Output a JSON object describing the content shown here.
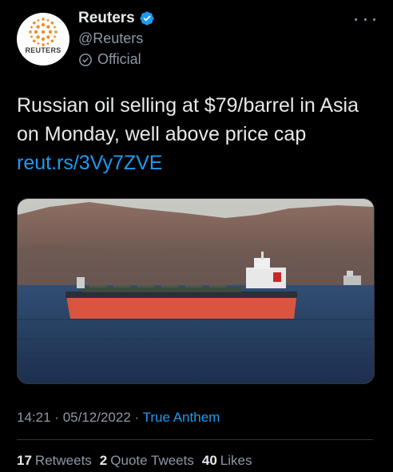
{
  "author": {
    "name": "Reuters",
    "handle": "@Reuters",
    "label": "Official",
    "avatar_text": "REUTERS"
  },
  "tweet": {
    "text": "Russian oil selling at $79/barrel in Asia on Monday, well above price cap ",
    "link": "reut.rs/3Vy7ZVE"
  },
  "meta": {
    "time": "14:21",
    "separator": "·",
    "date": "05/12/2022",
    "app": "True Anthem"
  },
  "stats": {
    "retweets_count": "17",
    "retweets_label": "Retweets",
    "quotes_count": "2",
    "quotes_label": "Quote Tweets",
    "likes_count": "40",
    "likes_label": "Likes"
  },
  "colors": {
    "accent": "#1d9bf0",
    "background": "#000000",
    "secondary_text": "#8b98a5"
  }
}
